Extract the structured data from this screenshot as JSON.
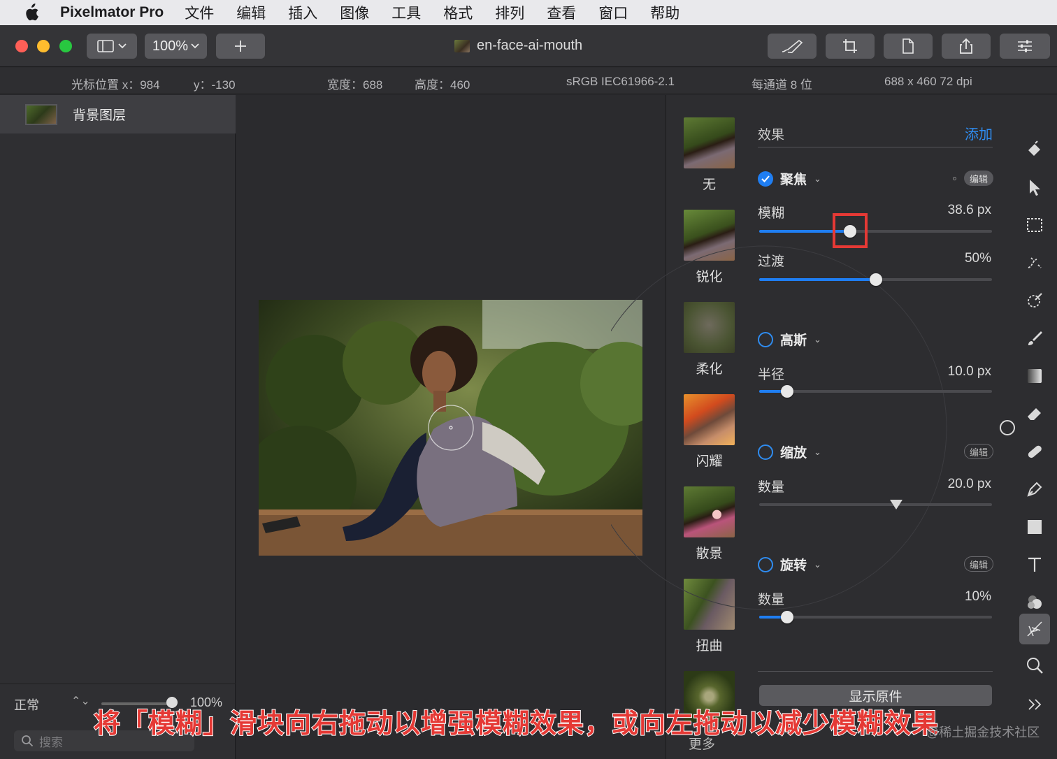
{
  "menubar": {
    "app_name": "Pixelmator Pro",
    "items": [
      "文件",
      "编辑",
      "插入",
      "图像",
      "工具",
      "格式",
      "排列",
      "查看",
      "窗口",
      "帮助"
    ]
  },
  "toolbar": {
    "zoom": "100%",
    "doc_title": "en-face-ai-mouth"
  },
  "infobar": {
    "cursor_x": "光标位置 x：984",
    "cursor_y": "y：-130",
    "width": "宽度：688",
    "height": "高度：460",
    "color_profile": "sRGB IEC61966-2.1",
    "bit_depth": "每通道 8 位",
    "size_dpi": "688 x 460 72 dpi"
  },
  "layers": {
    "layer_name": "背景图层",
    "blend_mode": "正常",
    "opacity": "100%",
    "search_placeholder": "搜索"
  },
  "effects_thumbs": [
    "无",
    "锐化",
    "柔化",
    "闪耀",
    "散景",
    "扭曲"
  ],
  "settings": {
    "header": "效果",
    "add": "添加",
    "groups": [
      {
        "title": "聚焦",
        "enabled": true,
        "edit": "编辑",
        "param": "模糊",
        "value": "38.6 px",
        "level": 0.39
      },
      {
        "param2": "过渡",
        "value2": "50%",
        "level2": 0.5
      },
      {
        "title": "高斯",
        "enabled": false,
        "param": "半径",
        "value": "10.0 px",
        "level": 0.12
      },
      {
        "title": "缩放",
        "enabled": false,
        "edit": "编辑",
        "param": "数量",
        "value": "20.0 px",
        "level": 0.59
      },
      {
        "title": "旋转",
        "enabled": false,
        "edit": "编辑",
        "param": "数量",
        "value": "10%",
        "level": 0.12
      }
    ],
    "show_original": "显示原件",
    "cut_off_label": "更多"
  },
  "caption": "将「模糊」滑块向右拖动以增强模糊效果，或向左拖动以减少模糊效果",
  "watermark": "@稀土掘金技术社区",
  "colors": {
    "accent": "#1f7ef2",
    "highlight": "#e53935"
  }
}
